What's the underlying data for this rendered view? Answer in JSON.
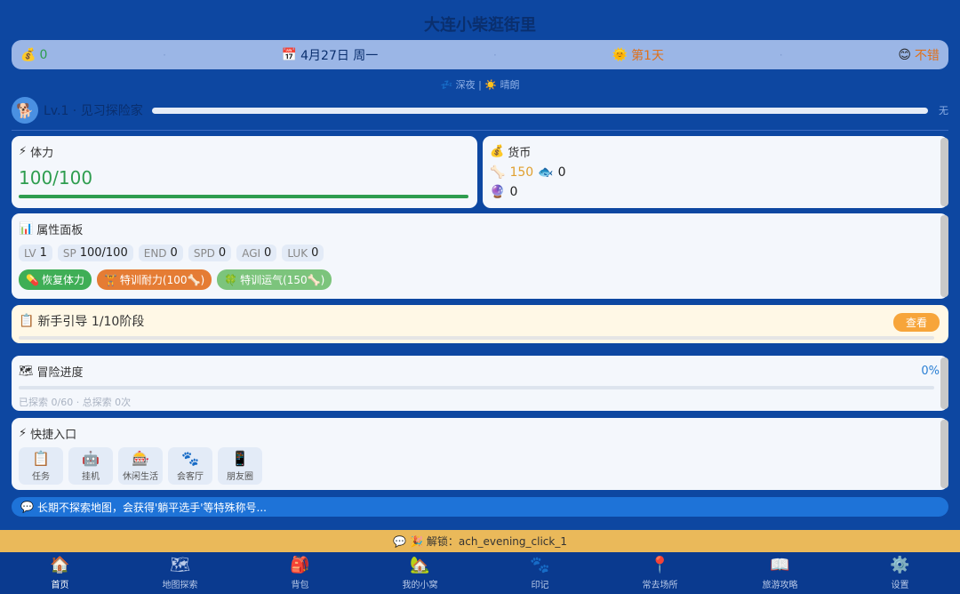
{
  "app": {
    "title": "大连小柴逛街里"
  },
  "topbar": {
    "money_icon": "money-bag-icon",
    "money": "0",
    "date_icon": "calendar-icon",
    "date": "4月27日 周一",
    "day_icon": "sun-icon",
    "day": "第1天",
    "mood_icon": "smile-icon",
    "mood": "不错",
    "separator": "·"
  },
  "timeline": {
    "period": "深夜",
    "divider": "|",
    "weather": "晴朗"
  },
  "level": {
    "label": "Lv.1 · 见习探险家",
    "xp_label": "无",
    "progress": 0
  },
  "stamina": {
    "title": "体力",
    "value": "100/100",
    "progress": 1.0,
    "color": "#2e9d4f"
  },
  "currency": {
    "title": "货币",
    "bone": "150",
    "fish": "0",
    "orb": "0"
  },
  "attributes": {
    "title": "属性面板",
    "stats": [
      {
        "key": "LV",
        "value": "1"
      },
      {
        "key": "SP",
        "value": "100/100"
      },
      {
        "key": "END",
        "value": "0"
      },
      {
        "key": "SPD",
        "value": "0"
      },
      {
        "key": "AGI",
        "value": "0"
      },
      {
        "key": "LUK",
        "value": "0"
      }
    ],
    "actions": [
      {
        "label": "恢复体力",
        "icon": "pill-icon"
      },
      {
        "label": "特训耐力(100🦴)",
        "icon": "dumbbell-icon"
      },
      {
        "label": "特训运气(150🦴)",
        "icon": "clover-icon"
      }
    ]
  },
  "guide": {
    "title": "新手引导 1/10阶段",
    "button": "查看"
  },
  "adventure": {
    "title": "冒险进度",
    "percent": "0%",
    "subtitle": "已探索 0/60 · 总探索 0次"
  },
  "quick": {
    "title": "快捷入口",
    "items": [
      {
        "label": "任务"
      },
      {
        "label": "挂机"
      },
      {
        "label": "休闲生活"
      },
      {
        "label": "会客厅"
      },
      {
        "label": "朋友圈"
      }
    ]
  },
  "tip": {
    "text": "长期不探索地图，会获得'躺平选手'等特殊称号..."
  },
  "unlock": {
    "text": "解锁：ach_evening_click_1"
  },
  "nav": {
    "items": [
      {
        "label": "首页"
      },
      {
        "label": "地图探索"
      },
      {
        "label": "背包"
      },
      {
        "label": "我的小窝"
      },
      {
        "label": "印记"
      },
      {
        "label": "常去场所"
      },
      {
        "label": "旅游攻略"
      },
      {
        "label": "设置"
      }
    ]
  }
}
